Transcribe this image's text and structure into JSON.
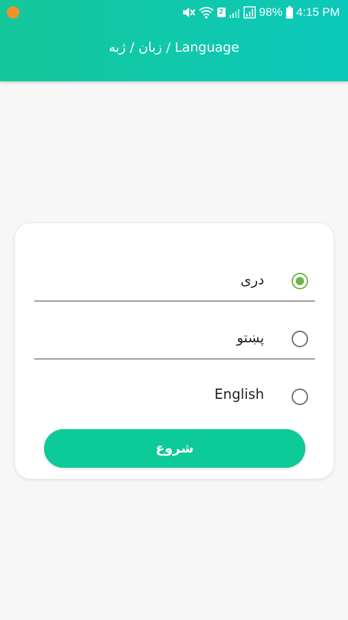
{
  "status_bar": {
    "battery": "98%",
    "time": "4:15 PM",
    "sim_slot": "2"
  },
  "header": {
    "title": "زبان / ژبه / Language"
  },
  "languages": [
    {
      "label": "دری",
      "selected": true
    },
    {
      "label": "پښتو",
      "selected": false
    },
    {
      "label": "English",
      "selected": false
    }
  ],
  "start_button": {
    "label": "شروع"
  },
  "colors": {
    "header_gradient_start": "#14c79b",
    "header_gradient_end": "#0cc8bb",
    "button": "#0dcb98",
    "radio_selected": "#6cb44a",
    "notification_dot": "#f0922b"
  }
}
